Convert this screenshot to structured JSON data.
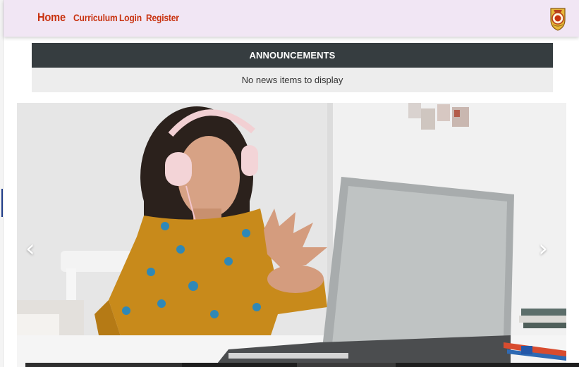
{
  "nav": {
    "home": "Home",
    "curriculum": "Curriculum",
    "login": "Login",
    "register": "Register",
    "brand_color": "#c8320f",
    "background": "#f1e6f4"
  },
  "logo": {
    "icon": "school-crest-icon"
  },
  "announcements": {
    "title": "ANNOUNCEMENTS",
    "empty_message": "No news items to display",
    "header_color": "#363d40"
  },
  "carousel": {
    "image": "girl-with-headphones-on-laptop-photo",
    "prev_icon": "chevron-left-icon",
    "next_icon": "chevron-right-icon"
  }
}
